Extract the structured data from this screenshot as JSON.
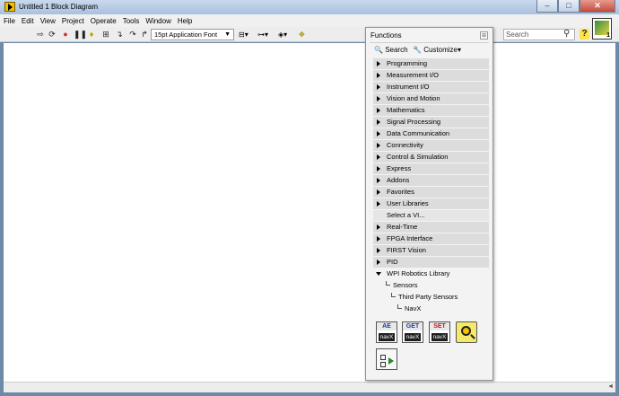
{
  "window": {
    "title": "Untitled 1 Block Diagram",
    "minimize_glyph": "–",
    "maximize_glyph": "□",
    "close_glyph": "✕"
  },
  "menu": [
    "File",
    "Edit",
    "View",
    "Project",
    "Operate",
    "Tools",
    "Window",
    "Help"
  ],
  "toolbar": {
    "font_select": "15pt Application Font",
    "search_placeholder": "Search",
    "vi_badge": "1",
    "icons": [
      "run-arrow-icon",
      "run-continuously-icon",
      "abort-icon",
      "pause-icon",
      "highlight-execution-icon",
      "retain-wire-values-icon",
      "step-into-icon",
      "step-over-icon",
      "step-out-icon",
      "align-objects-icon",
      "distribute-objects-icon",
      "reorder-icon",
      "cleanup-diagram-icon",
      "context-help-icon"
    ]
  },
  "palette": {
    "title": "Functions",
    "search_label": "Search",
    "customize_label": "Customize",
    "categories": [
      {
        "label": "Programming",
        "style": "folder"
      },
      {
        "label": "Measurement I/O",
        "style": "folder"
      },
      {
        "label": "Instrument I/O",
        "style": "folder"
      },
      {
        "label": "Vision and Motion",
        "style": "folder"
      },
      {
        "label": "Mathematics",
        "style": "folder"
      },
      {
        "label": "Signal Processing",
        "style": "folder"
      },
      {
        "label": "Data Communication",
        "style": "folder"
      },
      {
        "label": "Connectivity",
        "style": "folder"
      },
      {
        "label": "Control & Simulation",
        "style": "folder"
      },
      {
        "label": "Express",
        "style": "folder"
      },
      {
        "label": "Addons",
        "style": "folder"
      },
      {
        "label": "Favorites",
        "style": "folder"
      },
      {
        "label": "User Libraries",
        "style": "folder"
      },
      {
        "label": "Select a VI...",
        "style": "plain"
      },
      {
        "label": "Real-Time",
        "style": "folder"
      },
      {
        "label": "FPGA Interface",
        "style": "folder"
      },
      {
        "label": "FIRST Vision",
        "style": "folder"
      },
      {
        "label": "PID",
        "style": "folder"
      },
      {
        "label": "WPI Robotics Library",
        "style": "expanded"
      }
    ],
    "subtree": [
      "Sensors",
      "Third Party Sensors",
      "NavX"
    ],
    "vis": [
      {
        "top": "AE",
        "bottom": "navX",
        "color": "#1a3c9c"
      },
      {
        "top": "GET",
        "bottom": "navX",
        "color": "#1a3c9c"
      },
      {
        "top": "SET",
        "bottom": "navX",
        "color": "#c8151b"
      }
    ]
  },
  "status": {
    "scroll_indicator": "◄"
  }
}
